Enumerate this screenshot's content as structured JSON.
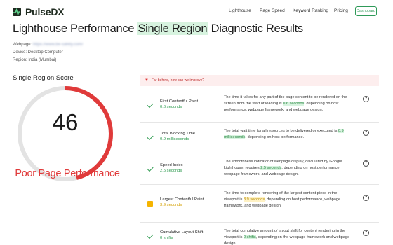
{
  "brand": {
    "name": "PulseDX",
    "accent": "#2f9a59"
  },
  "nav": {
    "items": [
      "Lighthouse",
      "Page Speed",
      "Keyword Ranking",
      "Pricing"
    ],
    "dashboard_label": "Dashboard"
  },
  "page": {
    "title_before": "Lighthouse Performance ",
    "title_highlight": "Single Region",
    "title_after": " Diagnostic Results",
    "webpage_label": "Webpage:",
    "webpage_url": "https://www.be-safety.com/",
    "device": "Device: Desktop Computer",
    "region": "Region: India (Mumbai)"
  },
  "score": {
    "label": "Single Region Score",
    "value": "46",
    "fraction": 0.46,
    "verdict": "Poor Page Performance",
    "color": "#e03a3a"
  },
  "banner": {
    "text": "Far behind, how can we improve?"
  },
  "metrics": [
    {
      "status": "good",
      "name": "First Contentful Paint",
      "value": "0.6 seconds",
      "desc_before": "The time it takes for any part of the page content to be rendered on the screen from the start of loading is ",
      "desc_highlight": "0.6 seconds",
      "desc_after": ", depending on host performance, webpage framework, and webpage design."
    },
    {
      "status": "good",
      "name": "Total Blocking Time",
      "value": "0.9 milliseconds",
      "desc_before": "The total wait time for all resources to be delivered or executed is ",
      "desc_highlight": "0.9 milliseconds",
      "desc_after": ", depending on host performance."
    },
    {
      "status": "good",
      "name": "Speed Index",
      "value": "2.5 seconds",
      "desc_before": "The smoothness indicator of webpage display, calculated by Google Lighthouse, requires ",
      "desc_highlight": "2.5 seconds",
      "desc_after": ", depending on host performance, webpage framework, and webpage design."
    },
    {
      "status": "warn",
      "name": "Largest Contentful Paint",
      "value": "3.9 seconds",
      "desc_before": "The time to complete rendering of the largest content piece in the viewport is ",
      "desc_highlight": "3.9 seconds",
      "desc_after": ", depending on host performance, webpage framework, and webpage design."
    },
    {
      "status": "good",
      "name": "Cumulative Layout Shift",
      "value": "0 shifts",
      "desc_before": "The total cumulative amount of layout shift for content rendering in the viewport is ",
      "desc_highlight": "0 shifts",
      "desc_after": ", depending on the webpage framework and webpage design."
    }
  ],
  "help_glyph": "?"
}
